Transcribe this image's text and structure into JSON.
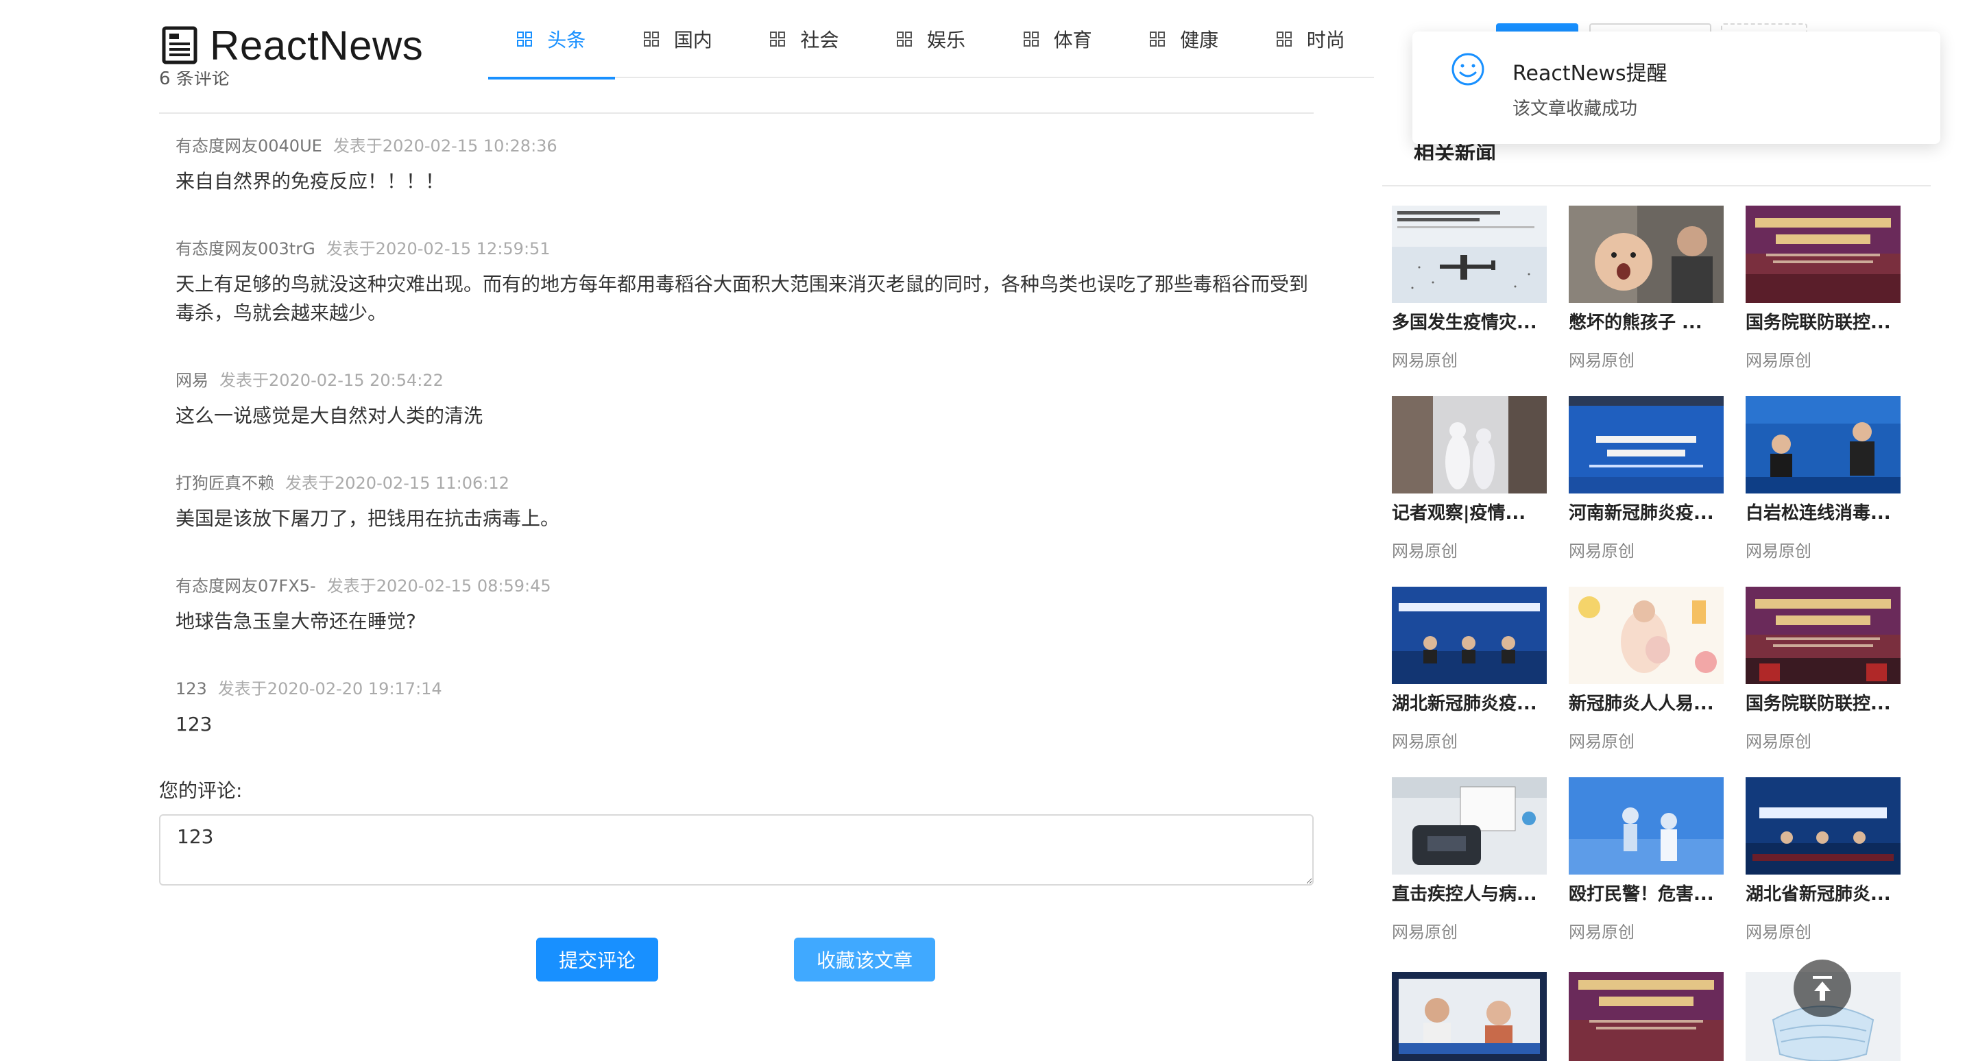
{
  "app": {
    "name": "ReactNews"
  },
  "nav": {
    "items": [
      {
        "label": "头条",
        "active": true
      },
      {
        "label": "国内",
        "active": false
      },
      {
        "label": "社会",
        "active": false
      },
      {
        "label": "娱乐",
        "active": false
      },
      {
        "label": "体育",
        "active": false
      },
      {
        "label": "健康",
        "active": false
      },
      {
        "label": "时尚",
        "active": false
      }
    ]
  },
  "comments": {
    "count_label": "6 条评论",
    "items": [
      {
        "user": "有态度网友0040UE",
        "time": "发表于2020-02-15 10:28:36",
        "content": "来自自然界的免疫反应！！！！"
      },
      {
        "user": "有态度网友003trG",
        "time": "发表于2020-02-15 12:59:51",
        "content": "天上有足够的鸟就没这种灾难出现。而有的地方每年都用毒稻谷大面积大范围来消灭老鼠的同时，各种鸟类也误吃了那些毒稻谷而受到毒杀，鸟就会越来越少。"
      },
      {
        "user": "网易",
        "time": "发表于2020-02-15 20:54:22",
        "content": "这么一说感觉是大自然对人类的清洗"
      },
      {
        "user": "打狗匠真不赖",
        "time": "发表于2020-02-15 11:06:12",
        "content": "美国是该放下屠刀了，把钱用在抗击病毒上。"
      },
      {
        "user": "有态度网友07FX5-",
        "time": "发表于2020-02-15 08:59:45",
        "content": "地球告急玉皇大帝还在睡觉?"
      },
      {
        "user": "123",
        "time": "发表于2020-02-20 19:17:14",
        "content": "123"
      }
    ]
  },
  "form": {
    "label": "您的评论:",
    "value": "123",
    "submit_label": "提交评论",
    "favorite_label": "收藏该文章"
  },
  "related": {
    "title": "相关新闻",
    "items": [
      {
        "title": "多国发生疫情灾...",
        "source": "网易原创"
      },
      {
        "title": "憋坏的熊孩子 ...",
        "source": "网易原创"
      },
      {
        "title": "国务院联防联控...",
        "source": "网易原创"
      },
      {
        "title": "记者观察|疫情...",
        "source": "网易原创"
      },
      {
        "title": "河南新冠肺炎疫...",
        "source": "网易原创"
      },
      {
        "title": "白岩松连线消毒...",
        "source": "网易原创"
      },
      {
        "title": "湖北新冠肺炎疫...",
        "source": "网易原创"
      },
      {
        "title": "新冠肺炎人人易...",
        "source": "网易原创"
      },
      {
        "title": "国务院联防联控...",
        "source": "网易原创"
      },
      {
        "title": "直击疾控人与病...",
        "source": "网易原创"
      },
      {
        "title": "殴打民警！危害...",
        "source": "网易原创"
      },
      {
        "title": "湖北省新冠肺炎...",
        "source": "网易原创"
      }
    ]
  },
  "notification": {
    "title": "ReactNews提醒",
    "description": "该文章收藏成功"
  },
  "colors": {
    "accent": "#1890ff",
    "accent_light": "#40a9ff"
  }
}
